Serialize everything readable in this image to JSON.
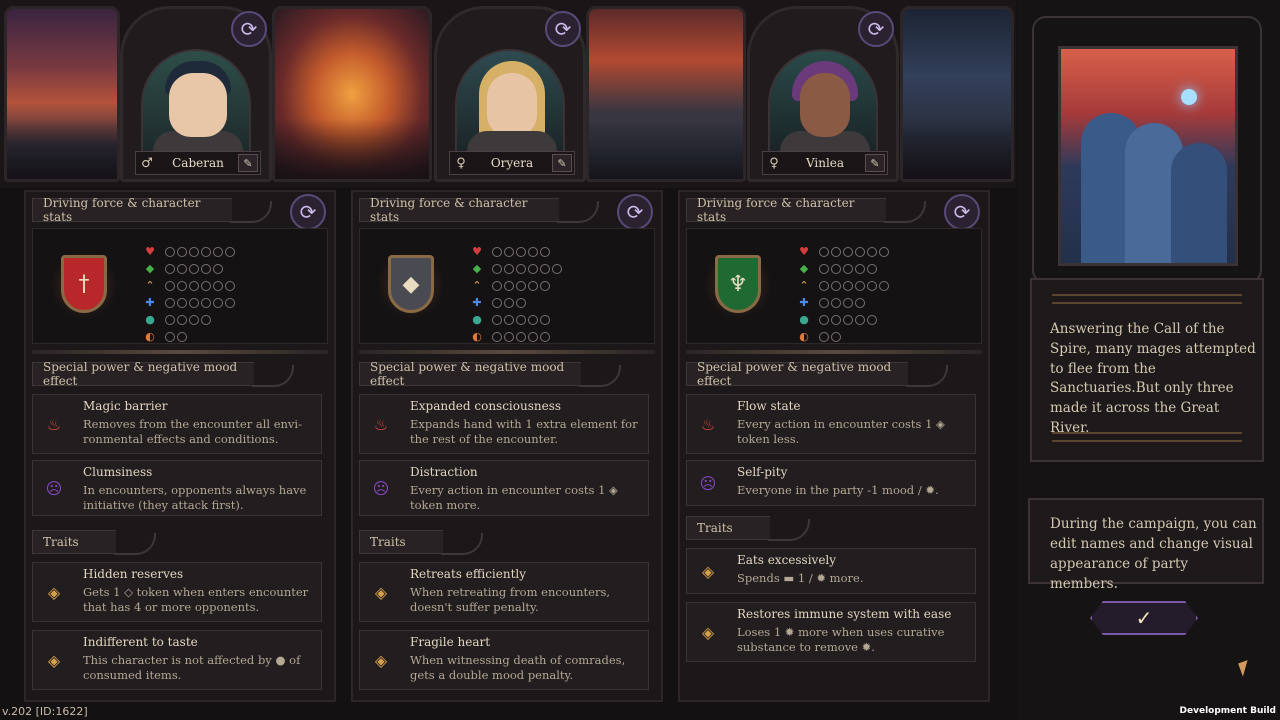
{
  "colors": {
    "background": "#141113",
    "panel": "#1c1819",
    "accent_purple": "#7a5aa8",
    "gold": "#d4a04a",
    "text": "#d4c8b0",
    "heart": "#d83c3c",
    "diamond_green": "#46b04a",
    "chevron_gold": "#e6b04a",
    "cross_blue": "#4a8ae6",
    "orb_teal": "#3aa890",
    "stomach_orange": "#e07a3a"
  },
  "stat_icons": [
    "heart-icon",
    "diamond-icon",
    "chevron-icon",
    "cross-icon",
    "orb-icon",
    "stomach-icon"
  ],
  "labels": {
    "stats_header": "Driving force & character stats",
    "special_header": "Special power & negative mood effect",
    "traits_header": "Traits"
  },
  "characters": [
    {
      "name": "Caberan",
      "sex_symbol": "♂",
      "crest_symbol": "†",
      "crest_color": "#b8282a",
      "stats": [
        6,
        5,
        6,
        6,
        4,
        2
      ],
      "power": {
        "title": "Magic barrier",
        "text": "Removes from the encounter all envi-ronmental effects and conditions."
      },
      "mood": {
        "title": "Clumsiness",
        "text": "In encounters, opponents always have initiative (they attack first)."
      },
      "traits": [
        {
          "title": "Hidden reserves",
          "text": "Gets 1 ◇ token when enters encounter that has 4 or more opponents."
        },
        {
          "title": "Indifferent to taste",
          "text": "This character is not affected by ● of consumed items."
        }
      ]
    },
    {
      "name": "Oryera",
      "sex_symbol": "♀",
      "crest_symbol": "◆",
      "crest_color": "#4a4a52",
      "stats": [
        5,
        6,
        5,
        3,
        5,
        5
      ],
      "power": {
        "title": "Expanded consciousness",
        "text": "Expands hand with 1 extra element for the rest of the encounter."
      },
      "mood": {
        "title": "Distraction",
        "text": "Every action in encounter costs 1 ◈ token more."
      },
      "traits": [
        {
          "title": "Retreats efficiently",
          "text": "When retreating from encounters, doesn't suffer penalty."
        },
        {
          "title": "Fragile heart",
          "text": "When witnessing death of comrades, gets a double mood penalty."
        }
      ]
    },
    {
      "name": "Vinlea",
      "sex_symbol": "♀",
      "crest_symbol": "♆",
      "crest_color": "#1e6a32",
      "stats": [
        6,
        5,
        6,
        4,
        5,
        2
      ],
      "power": {
        "title": "Flow state",
        "text": "Every action in encounter costs 1 ◈ token less."
      },
      "mood": {
        "title": "Self-pity",
        "text": "Everyone in the party -1 mood / ✹."
      },
      "traits": [
        {
          "title": "Eats excessively",
          "text": "Spends ▬ 1 / ✹ more."
        },
        {
          "title": "Restores immune system with ease",
          "text": "Loses 1 ✹ more when uses curative substance to remove ✹."
        }
      ]
    }
  ],
  "lore_text": "Answering the Call of the Spire, many mages attempted to flee from the Sanctuaries.But only three made it across the Great River.",
  "hint_text": "During the campaign, you can edit names and change visual appearance of party members.",
  "confirm_symbol": "✓",
  "refresh_symbol": "⟳",
  "edit_symbol": "✎",
  "version": "v.202 [ID:1622]",
  "build_label": "Development Build"
}
